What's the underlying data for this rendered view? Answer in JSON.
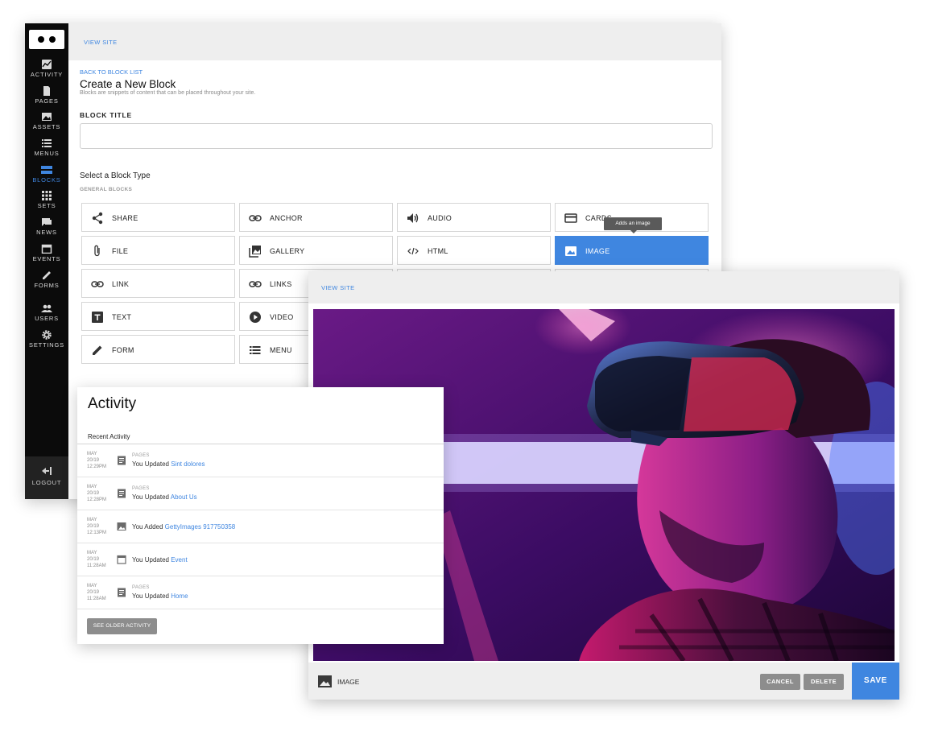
{
  "cms": {
    "view_site": "VIEW SITE",
    "back_link": "BACK TO BLOCK LIST",
    "title": "Create a New Block",
    "subtitle": "Blocks are snippets of content that can be placed throughout your site.",
    "block_title_label": "BLOCK TITLE",
    "block_title_value": "",
    "select_type_label": "Select a Block Type",
    "general_blocks_label": "GENERAL BLOCKS",
    "tooltip": "Adds an image",
    "blocks": [
      {
        "label": "SHARE",
        "icon": "share-icon"
      },
      {
        "label": "ANCHOR",
        "icon": "link-icon"
      },
      {
        "label": "AUDIO",
        "icon": "speaker-icon"
      },
      {
        "label": "CARDS",
        "icon": "card-icon"
      },
      {
        "label": "FILE",
        "icon": "paperclip-icon"
      },
      {
        "label": "GALLERY",
        "icon": "gallery-icon"
      },
      {
        "label": "HTML",
        "icon": "code-icon"
      },
      {
        "label": "IMAGE",
        "icon": "image-icon",
        "selected": true
      },
      {
        "label": "LINK",
        "icon": "link-icon"
      },
      {
        "label": "LINKS",
        "icon": "link-icon"
      },
      {
        "label": "TEXT",
        "icon": "text-icon"
      },
      {
        "label": "VIDEO",
        "icon": "play-icon"
      },
      {
        "label": "FORM",
        "icon": "pencil-icon"
      },
      {
        "label": "MENU",
        "icon": "list-icon"
      }
    ]
  },
  "sidebar": {
    "items": [
      {
        "label": "ACTIVITY",
        "icon": "chart-icon"
      },
      {
        "label": "PAGES",
        "icon": "page-icon"
      },
      {
        "label": "ASSETS",
        "icon": "image-icon"
      },
      {
        "label": "MENUS",
        "icon": "list-icon"
      },
      {
        "label": "BLOCKS",
        "icon": "blocks-icon",
        "active": true
      },
      {
        "label": "SETS",
        "icon": "grid-icon"
      },
      {
        "label": "NEWS",
        "icon": "chat-icon"
      },
      {
        "label": "EVENTS",
        "icon": "calendar-icon"
      },
      {
        "label": "FORMS",
        "icon": "pencil-icon"
      },
      {
        "label": "USERS",
        "icon": "users-icon"
      },
      {
        "label": "SETTINGS",
        "icon": "gear-icon"
      }
    ],
    "logout": "LOGOUT"
  },
  "image_editor": {
    "view_site": "VIEW SITE",
    "footer_label": "IMAGE",
    "cancel": "CANCEL",
    "delete": "DELETE",
    "save": "SAVE"
  },
  "activity": {
    "title": "Activity",
    "recent_label": "Recent Activity",
    "rows": [
      {
        "month": "MAY",
        "day": "20/19",
        "time": "12:29PM",
        "category": "PAGES",
        "action": "You Updated ",
        "target": "Sint dolores",
        "icon": "page-icon"
      },
      {
        "month": "MAY",
        "day": "20/19",
        "time": "12:28PM",
        "category": "PAGES",
        "action": "You Updated ",
        "target": "About Us",
        "icon": "page-icon"
      },
      {
        "month": "MAY",
        "day": "20/19",
        "time": "12:13PM",
        "category": "",
        "action": "You Added ",
        "target": "GettyImages 917750358",
        "icon": "image-icon"
      },
      {
        "month": "MAY",
        "day": "20/19",
        "time": "11:28AM",
        "category": "",
        "action": "You Updated ",
        "target": "Event",
        "icon": "calendar-icon"
      },
      {
        "month": "MAY",
        "day": "20/19",
        "time": "11:28AM",
        "category": "PAGES",
        "action": "You Updated ",
        "target": "Home",
        "icon": "page-icon"
      }
    ],
    "see_older": "SEE OLDER ACTIVITY"
  },
  "colors": {
    "accent": "#3f86e0",
    "sidebar_bg": "#0b0b0b",
    "panel_bg": "#eeeeee",
    "button_gray": "#8d8d8d"
  }
}
